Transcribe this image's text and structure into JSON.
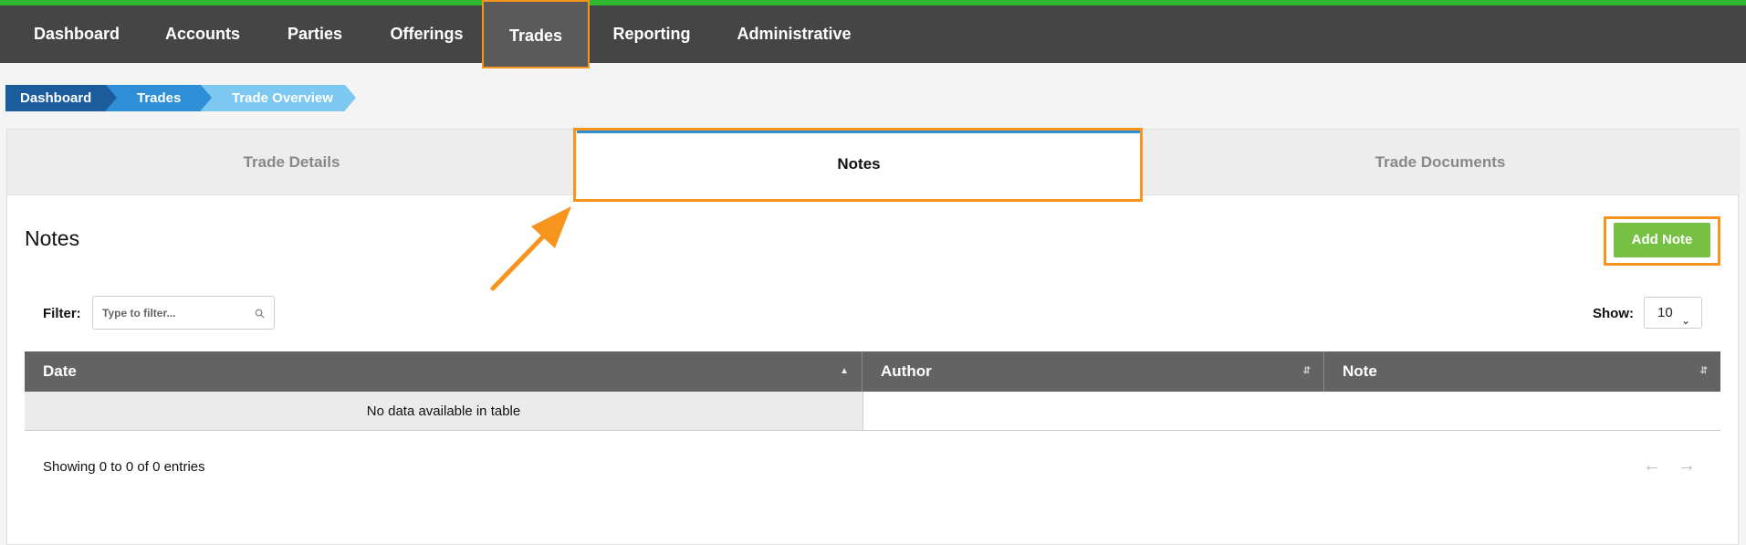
{
  "nav": {
    "items": [
      {
        "label": "Dashboard"
      },
      {
        "label": "Accounts"
      },
      {
        "label": "Parties"
      },
      {
        "label": "Offerings"
      },
      {
        "label": "Trades"
      },
      {
        "label": "Reporting"
      },
      {
        "label": "Administrative"
      }
    ],
    "active": "Trades"
  },
  "breadcrumb": [
    "Dashboard",
    "Trades",
    "Trade Overview"
  ],
  "tabs": [
    {
      "label": "Trade Details"
    },
    {
      "label": "Notes"
    },
    {
      "label": "Trade Documents"
    }
  ],
  "section": {
    "title": "Notes",
    "add_button": "Add Note"
  },
  "filter": {
    "label": "Filter:",
    "placeholder": "Type to filter..."
  },
  "show": {
    "label": "Show:",
    "value": "10"
  },
  "table": {
    "columns": [
      "Date",
      "Author",
      "Note"
    ],
    "empty_message": "No data available in table",
    "info": "Showing 0 to 0 of 0 entries"
  },
  "pager": {
    "prev": "←",
    "next": "→"
  },
  "colors": {
    "accent_orange": "#f7941d",
    "nav_bg": "#454545",
    "top_border": "#2eb82e",
    "button_green": "#76c043",
    "tab_active_top": "#2e8fd6"
  }
}
